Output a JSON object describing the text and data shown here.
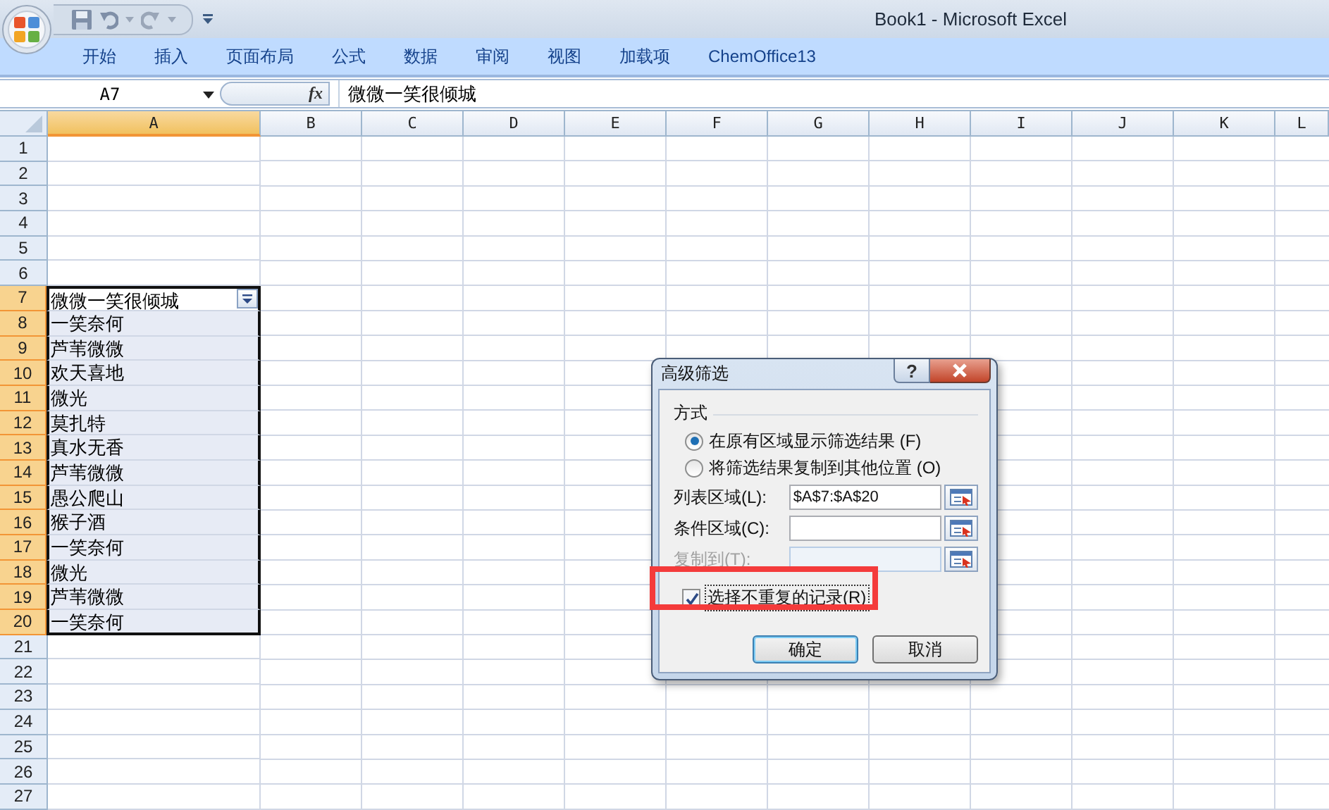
{
  "window": {
    "title": "Book1 - Microsoft Excel"
  },
  "ribbon_tabs": [
    {
      "label": "开始"
    },
    {
      "label": "插入"
    },
    {
      "label": "页面布局"
    },
    {
      "label": "公式"
    },
    {
      "label": "数据"
    },
    {
      "label": "审阅"
    },
    {
      "label": "视图"
    },
    {
      "label": "加载项"
    },
    {
      "label": "ChemOffice13"
    }
  ],
  "formula_bar": {
    "name_box": "A7",
    "fx": "fx",
    "formula": "微微一笑很倾城"
  },
  "columns": [
    {
      "label": "A",
      "selected": true
    },
    {
      "label": "B",
      "selected": false
    },
    {
      "label": "C",
      "selected": false
    },
    {
      "label": "D",
      "selected": false
    },
    {
      "label": "E",
      "selected": false
    },
    {
      "label": "F",
      "selected": false
    },
    {
      "label": "G",
      "selected": false
    },
    {
      "label": "H",
      "selected": false
    },
    {
      "label": "I",
      "selected": false
    },
    {
      "label": "J",
      "selected": false
    },
    {
      "label": "K",
      "selected": false
    },
    {
      "label": "L",
      "selected": false
    }
  ],
  "rows": [
    {
      "label": "1",
      "selected": false,
      "active": false,
      "filter": false
    },
    {
      "label": "2",
      "selected": false,
      "active": false,
      "filter": false
    },
    {
      "label": "3",
      "selected": false,
      "active": false,
      "filter": false
    },
    {
      "label": "4",
      "selected": false,
      "active": false,
      "filter": false
    },
    {
      "label": "5",
      "selected": false,
      "active": false,
      "filter": false
    },
    {
      "label": "6",
      "selected": false,
      "active": false,
      "filter": false
    },
    {
      "label": "7",
      "selected": true,
      "active": true,
      "filter": true,
      "cell_a": "微微一笑很倾城"
    },
    {
      "label": "8",
      "selected": true,
      "active": false,
      "filter": false,
      "cell_a": "一笑奈何"
    },
    {
      "label": "9",
      "selected": true,
      "active": false,
      "filter": false,
      "cell_a": "芦苇微微"
    },
    {
      "label": "10",
      "selected": true,
      "active": false,
      "filter": false,
      "cell_a": "欢天喜地"
    },
    {
      "label": "11",
      "selected": true,
      "active": false,
      "filter": false,
      "cell_a": "微光"
    },
    {
      "label": "12",
      "selected": true,
      "active": false,
      "filter": false,
      "cell_a": "莫扎特"
    },
    {
      "label": "13",
      "selected": true,
      "active": false,
      "filter": false,
      "cell_a": "真水无香"
    },
    {
      "label": "14",
      "selected": true,
      "active": false,
      "filter": false,
      "cell_a": "芦苇微微"
    },
    {
      "label": "15",
      "selected": true,
      "active": false,
      "filter": false,
      "cell_a": "愚公爬山"
    },
    {
      "label": "16",
      "selected": true,
      "active": false,
      "filter": false,
      "cell_a": "猴子酒"
    },
    {
      "label": "17",
      "selected": true,
      "active": false,
      "filter": false,
      "cell_a": "一笑奈何"
    },
    {
      "label": "18",
      "selected": true,
      "active": false,
      "filter": false,
      "cell_a": "微光"
    },
    {
      "label": "19",
      "selected": true,
      "active": false,
      "filter": false,
      "cell_a": "芦苇微微"
    },
    {
      "label": "20",
      "selected": true,
      "active": false,
      "filter": false,
      "cell_a": "一笑奈何"
    },
    {
      "label": "21",
      "selected": false,
      "active": false,
      "filter": false
    },
    {
      "label": "22",
      "selected": false,
      "active": false,
      "filter": false
    },
    {
      "label": "23",
      "selected": false,
      "active": false,
      "filter": false
    },
    {
      "label": "24",
      "selected": false,
      "active": false,
      "filter": false
    },
    {
      "label": "25",
      "selected": false,
      "active": false,
      "filter": false
    },
    {
      "label": "26",
      "selected": false,
      "active": false,
      "filter": false
    },
    {
      "label": "27",
      "selected": false,
      "active": false,
      "filter": false
    }
  ],
  "dialog": {
    "title": "高级筛选",
    "help": "?",
    "group_label": "方式",
    "options": [
      {
        "label": "在原有区域显示筛选结果 (F)",
        "selected": true
      },
      {
        "label": "将筛选结果复制到其他位置 (O)",
        "selected": false
      }
    ],
    "fields": [
      {
        "label": "列表区域(L):",
        "value": "$A$7:$A$20",
        "disabled": false
      },
      {
        "label": "条件区域(C):",
        "disabled": false
      },
      {
        "label": "复制到(T):",
        "disabled": true
      }
    ],
    "checkbox": {
      "label": "选择不重复的记录(R)",
      "checked": true,
      "highlighted": true
    },
    "buttons": [
      {
        "label": "确定",
        "default": true
      },
      {
        "label": "取消",
        "default": false
      }
    ]
  }
}
